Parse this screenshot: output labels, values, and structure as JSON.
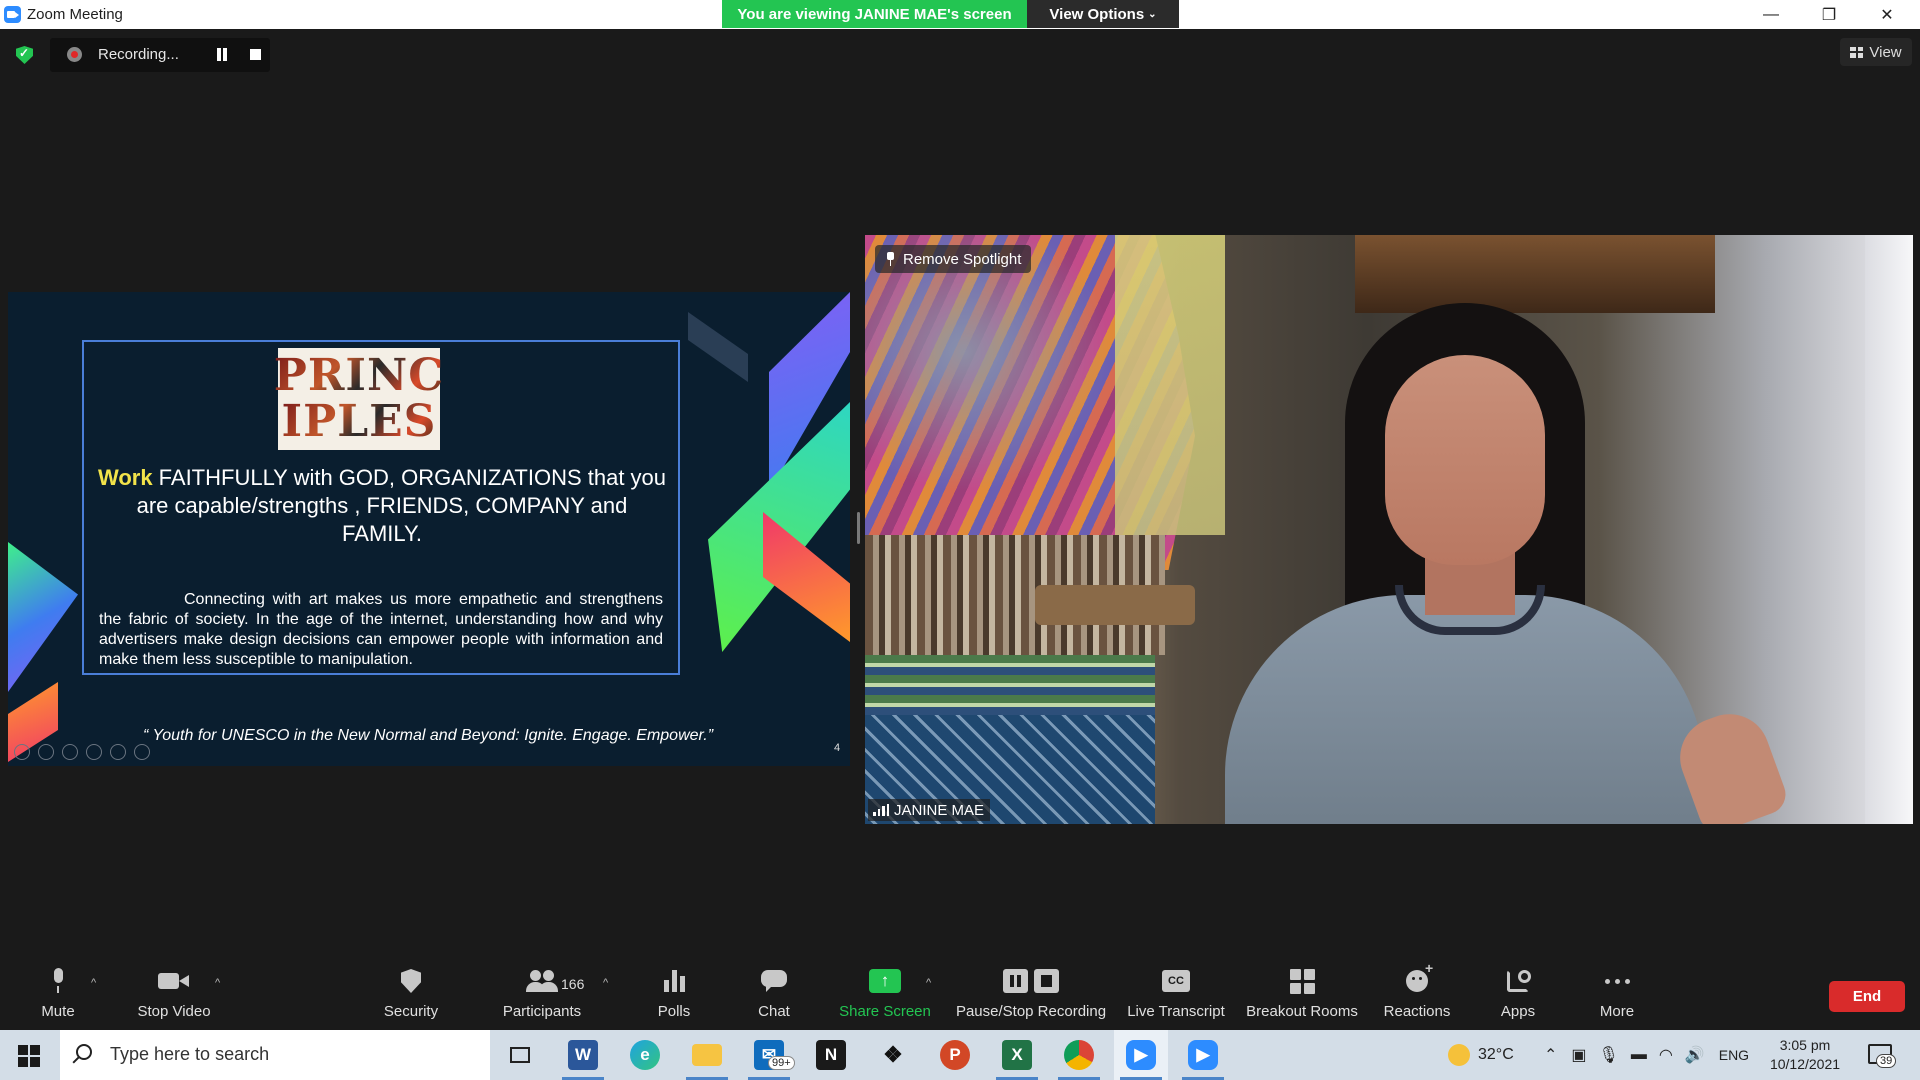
{
  "window": {
    "title": "Zoom Meeting",
    "viewing_banner": "You are viewing JANINE MAE's screen",
    "view_options": "View Options",
    "minimize": "—",
    "restore": "❐",
    "close": "✕"
  },
  "meeting_bar": {
    "recording_label": "Recording...",
    "view_label": "View"
  },
  "shared_slide": {
    "logo_line1": "PRINC",
    "logo_line2": "IPLES",
    "headline_highlight": "Work",
    "headline_rest": " FAITHFULLY with GOD, ORGANIZATIONS that you are capable/strengths , FRIENDS, COMPANY and FAMILY.",
    "body": "Connecting with art makes us more empathetic and strengthens the fabric of society. In the age of the internet, understanding how and why advertisers make design decisions can empower people with information and make them less susceptible to manipulation.",
    "quote": "“ Youth for UNESCO in the New Normal and Beyond: Ignite. Engage. Empower.”",
    "slide_number": "4"
  },
  "video": {
    "remove_spotlight": "Remove Spotlight",
    "participant_name": "JANINE MAE"
  },
  "toolbar": {
    "mute": "Mute",
    "stop_video": "Stop Video",
    "security": "Security",
    "participants": "Participants",
    "participant_count": "166",
    "polls": "Polls",
    "chat": "Chat",
    "share_screen": "Share Screen",
    "pause_stop_recording": "Pause/Stop Recording",
    "live_transcript": "Live Transcript",
    "cc": "CC",
    "breakout_rooms": "Breakout Rooms",
    "reactions": "Reactions",
    "apps": "Apps",
    "more": "More",
    "end": "End",
    "share_color": "#23c552",
    "end_color": "#d92b2b"
  },
  "taskbar": {
    "search_placeholder": "Type here to search",
    "mail_badge": "99+",
    "weather": "32°C",
    "language": "ENG",
    "time": "3:05 pm",
    "date": "10/12/2021",
    "notifications": "39"
  }
}
